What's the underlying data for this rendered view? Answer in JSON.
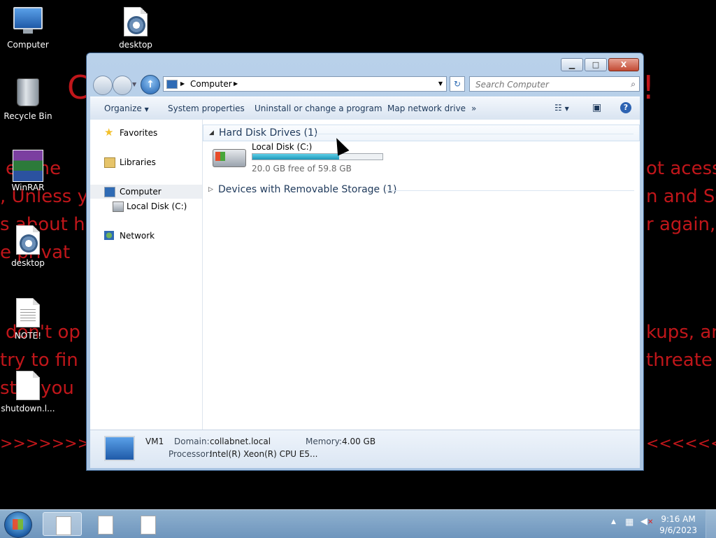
{
  "desktop": {
    "icons": [
      {
        "label": "Computer"
      },
      {
        "label": "desktop"
      },
      {
        "label": "Recycle Bin"
      },
      {
        "label": "WinRAR"
      },
      {
        "label": "desktop"
      },
      {
        "label": "NOTE!"
      },
      {
        "label": "shutdown.l..."
      }
    ],
    "background_text": {
      "line1": "C",
      "line1b": "!",
      "line2a": "es me",
      "line2b": "ot acessi",
      "line3a": ", Unless y",
      "line3b": "n and Se",
      "line4a": "s about h",
      "line4b": "r again,",
      "line5a": "e privat",
      "line6a": "don't op",
      "line6b": "kups, an",
      "line7a": "try to fin",
      "line7b": "threate",
      "line8a": "stry you",
      "line9a": ">>>>>>>>:",
      "line9b": "<<<<<<<<"
    },
    "colors": {
      "ransom_text": "#c0161a",
      "background": "#000000"
    }
  },
  "window": {
    "buttons": {
      "minimize": "▁",
      "maximize": "□",
      "close": "X"
    },
    "address": {
      "crumbs": [
        "Computer"
      ]
    },
    "search": {
      "placeholder": "Search Computer"
    },
    "toolbar": {
      "organize": "Organize",
      "system_properties": "System properties",
      "uninstall": "Uninstall or change a program",
      "map_drive": "Map network drive",
      "more": "»"
    },
    "nav": {
      "favorites": "Favorites",
      "libraries": "Libraries",
      "computer": "Computer",
      "local_disk": "Local Disk (C:)",
      "network": "Network"
    },
    "groups": {
      "hard_disk": "Hard Disk Drives (1)",
      "removable": "Devices with Removable Storage (1)"
    },
    "drive": {
      "name": "Local Disk (C:)",
      "free_text": "20.0 GB free of 59.8 GB",
      "used_fraction": 0.666
    },
    "details": {
      "name": "VM1",
      "domain_label": "Domain:",
      "domain_value": "collabnet.local",
      "memory_label": "Memory:",
      "memory_value": "4.00 GB",
      "processor_label": "Processor:",
      "processor_value": "Intel(R) Xeon(R) CPU E5..."
    }
  },
  "taskbar": {
    "time": "9:16 AM",
    "date": "9/6/2023",
    "tasks": [
      "notepad-1",
      "notepad-2",
      "notepad-3"
    ]
  }
}
